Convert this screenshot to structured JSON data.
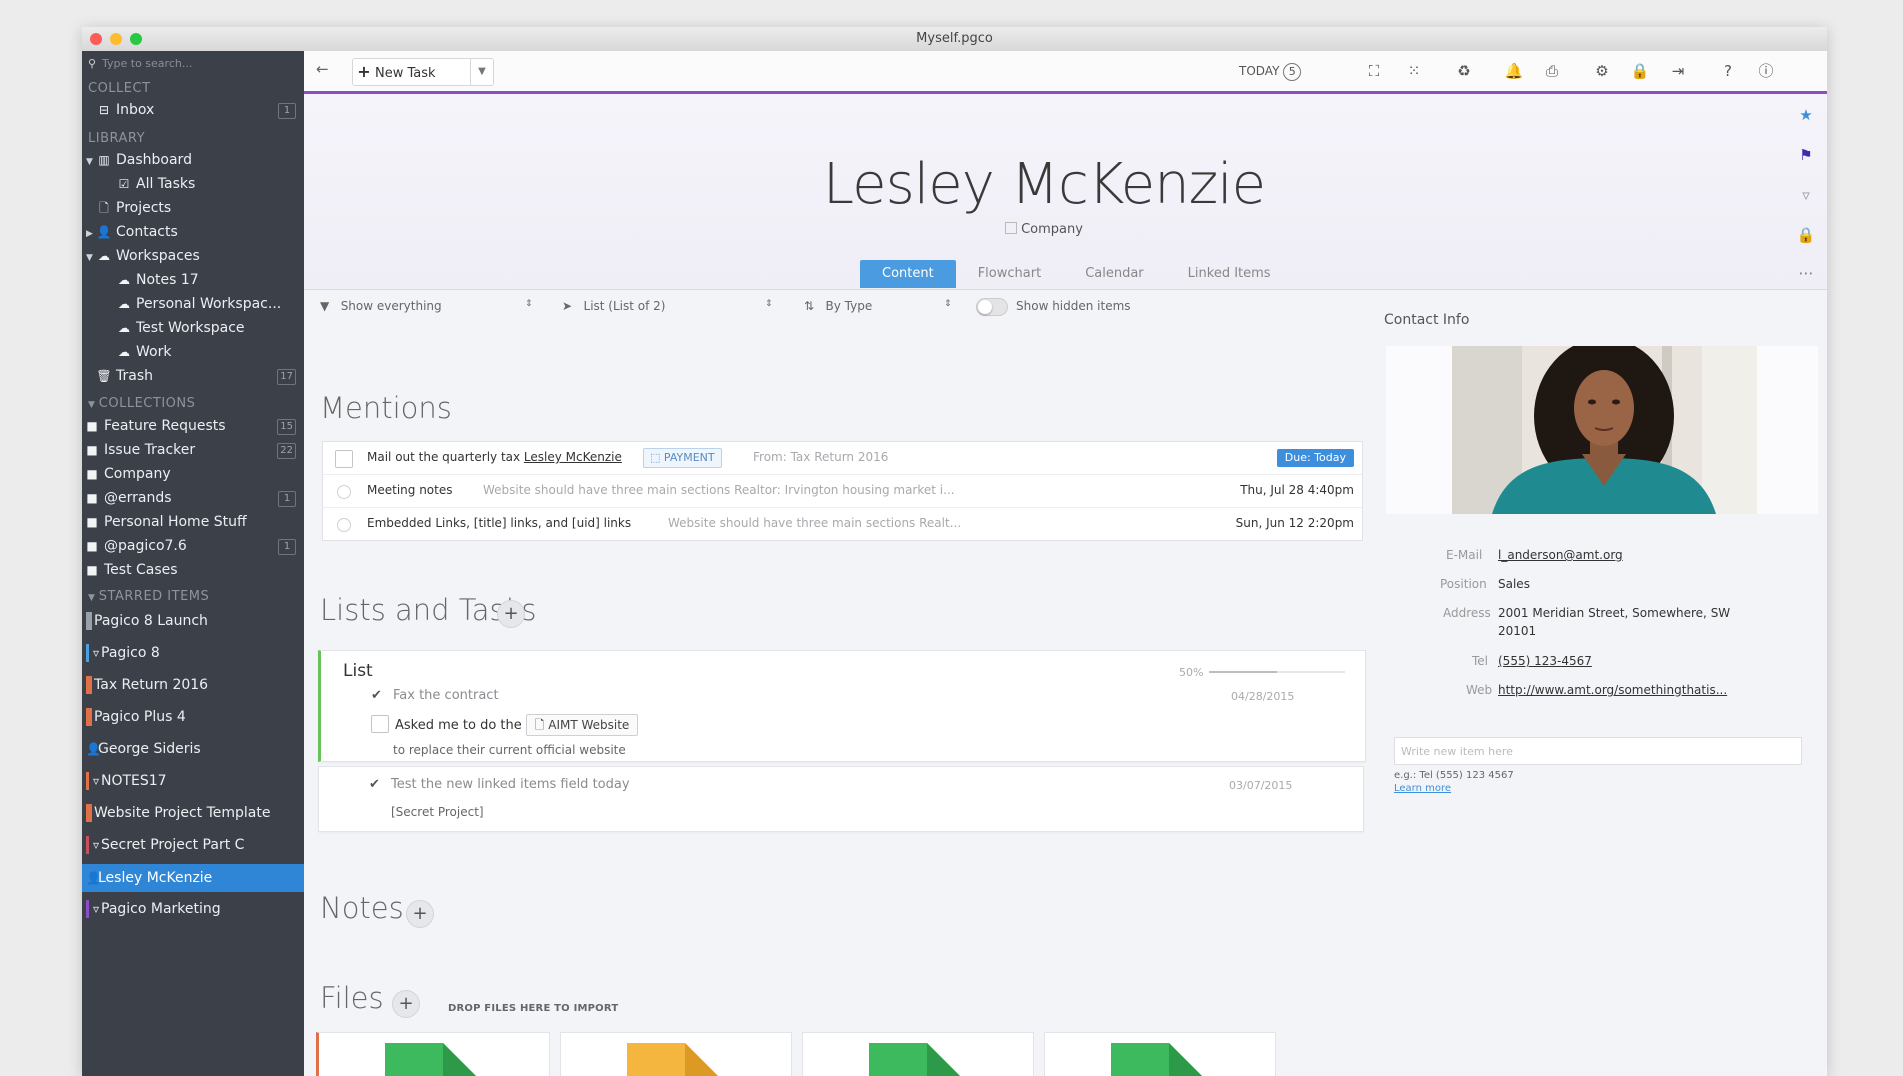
{
  "window": {
    "title": "Myself.pgco"
  },
  "sidebar": {
    "search_placeholder": "Type to search...",
    "sections": {
      "collect": "COLLECT",
      "library": "LIBRARY",
      "collections": "COLLECTIONS",
      "starred": "STARRED ITEMS"
    },
    "inbox": {
      "label": "Inbox",
      "count": "1"
    },
    "library": [
      {
        "label": "Dashboard"
      },
      {
        "label": "All Tasks"
      },
      {
        "label": "Projects"
      },
      {
        "label": "Contacts"
      },
      {
        "label": "Workspaces"
      },
      {
        "label": "Notes 17"
      },
      {
        "label": "Personal Workspac..."
      },
      {
        "label": "Test Workspace"
      },
      {
        "label": "Work"
      },
      {
        "label": "Trash",
        "count": "17"
      }
    ],
    "collections": [
      {
        "label": "Feature Requests",
        "count": "15"
      },
      {
        "label": "Issue Tracker",
        "count": "22"
      },
      {
        "label": "Company",
        "count": ""
      },
      {
        "label": "@errands",
        "count": "1"
      },
      {
        "label": "Personal Home Stuff",
        "count": ""
      },
      {
        "label": "@pagico7.6",
        "count": "1"
      },
      {
        "label": "Test Cases",
        "count": ""
      }
    ],
    "starred": [
      {
        "label": "Pagico 8 Launch",
        "color": "#9aa0a8"
      },
      {
        "label": "Pagico 8",
        "color": "#4aa0de"
      },
      {
        "label": "Tax Return 2016",
        "color": "#e0704a"
      },
      {
        "label": "Pagico Plus 4",
        "color": "#e0704a"
      },
      {
        "label": "George Sideris",
        "color": ""
      },
      {
        "label": "NOTES17",
        "color": "#e0704a"
      },
      {
        "label": "Website Project Template",
        "color": "#e0704a"
      },
      {
        "label": "Secret Project Part C",
        "color": "#c8505a"
      },
      {
        "label": "Lesley McKenzie",
        "color": ""
      },
      {
        "label": "Pagico Marketing",
        "color": "#8a4fc7"
      }
    ]
  },
  "toolbar": {
    "new_task": "New Task",
    "today_label": "TODAY",
    "today_count": "5"
  },
  "header": {
    "name": "Lesley McKenzie",
    "company_label": "Company",
    "tabs": [
      "Content",
      "Flowchart",
      "Calendar",
      "Linked Items"
    ]
  },
  "filters": {
    "show": "Show everything",
    "list": "List (List of 2)",
    "sort": "By Type",
    "hidden": "Show hidden items"
  },
  "mentions": {
    "title": "Mentions",
    "rows": [
      {
        "title_prefix": "Mail out the quarterly tax ",
        "title_link": "Lesley McKenzie",
        "tag": "PAYMENT",
        "meta": "From: Tax Return 2016",
        "due": "Due: Today"
      },
      {
        "title": "Meeting notes",
        "meta": "Website should have three main sections   Realtor: Irvington housing market i...",
        "date": "Thu, Jul 28 4:40pm"
      },
      {
        "title": "Embedded Links, [title] links, and [uid] links",
        "meta": "Website should have three main sections   Realt...",
        "date": "Sun, Jun 12 2:20pm"
      }
    ]
  },
  "lists": {
    "title": "Lists and Tasks",
    "list_title": "List",
    "progress": 0.5,
    "progress_label": "50%",
    "tasks": [
      {
        "title": "Fax the contract",
        "date": "04/28/2015"
      },
      {
        "title": "Asked me to do the",
        "chip": "AIMT Website",
        "sub": "to replace their current official website"
      },
      {
        "title": "Test the new linked items field today",
        "sub": "[Secret Project]",
        "date": "03/07/2015"
      }
    ]
  },
  "notes": {
    "title": "Notes"
  },
  "files": {
    "title": "Files",
    "drop_hint": "DROP FILES HERE TO IMPORT",
    "colors": [
      "#3dba5e",
      "#f4b63e",
      "#3dba5e",
      "#3dba5e"
    ]
  },
  "contact": {
    "label": "Contact Info",
    "fields": [
      {
        "key": "E-Mail",
        "value": "l_anderson@amt.org"
      },
      {
        "key": "Position",
        "value": "Sales"
      },
      {
        "key": "Address",
        "value": "2001 Meridian Street, Somewhere, SW",
        "value2": "20101"
      },
      {
        "key": "Tel",
        "value": "(555) 123-4567"
      },
      {
        "key": "Web",
        "value": "http://www.amt.org/somethingthatis..."
      }
    ],
    "new_item_placeholder": "Write new item here",
    "hint": "e.g.: Tel (555) 123 4567",
    "learn_more": "Learn more"
  }
}
